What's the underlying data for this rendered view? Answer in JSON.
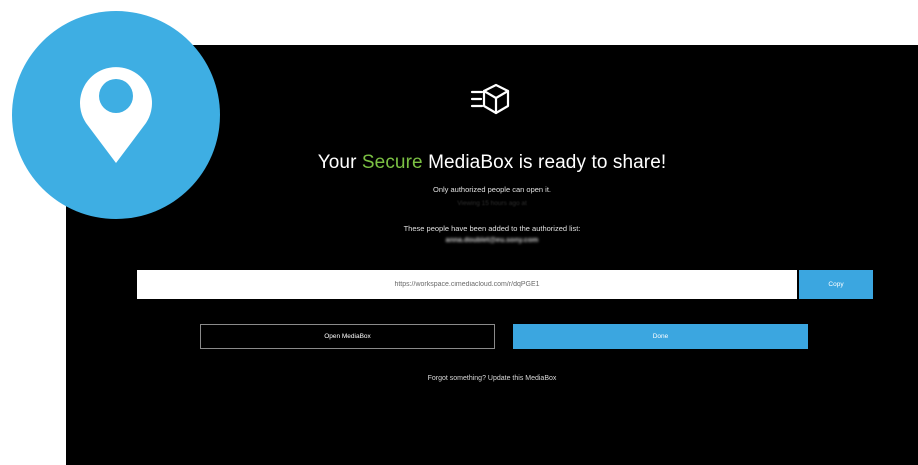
{
  "colors": {
    "background": "#000000",
    "accent_green": "#7bc043",
    "accent_blue": "#3ba6e0",
    "badge_blue": "#3eaee3"
  },
  "badge": {
    "icon": "map-pin-icon"
  },
  "logo": {
    "icon": "moving-box-icon"
  },
  "headline": {
    "prefix": "Your ",
    "accent": "Secure",
    "suffix": " MediaBox is ready to share!"
  },
  "subtitle": "Only authorized people can open it.",
  "faint_note": "Viewing 15 hours ago at",
  "authorized": {
    "title": "These people have been added to the authorized list:",
    "email": "anna.doublet@eu.sony.com"
  },
  "share_link": {
    "value": "https://workspace.cimediacloud.com/r/dqPGE1",
    "copy_label": "Copy"
  },
  "actions": {
    "open_label": "Open MediaBox",
    "done_label": "Done"
  },
  "footer": {
    "forgot_text": "Forgot something? Update this MediaBox"
  }
}
